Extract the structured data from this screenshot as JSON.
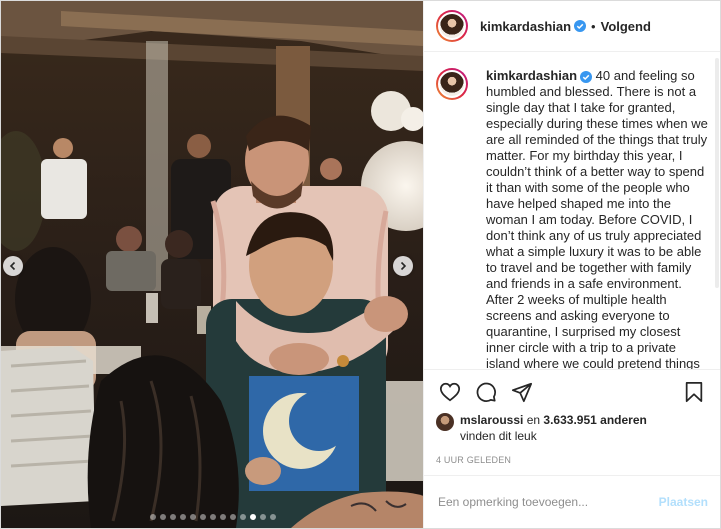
{
  "header": {
    "username": "kimkardashian",
    "separator": "•",
    "follow_label": "Volgend"
  },
  "caption": {
    "username": "kimkardashian",
    "text": "40 and feeling so humbled and blessed. There is not a single day that I take for granted, especially during these times when we are all reminded of the things that truly matter. For my birthday this year, I couldn’t think of a better way to spend it than with some of the people who have helped shaped me into the woman I am today. Before COVID, I don’t think any of us truly appreciated what a simple luxury it was to be able to travel and be together with family and friends in a safe environment. After 2 weeks of multiple health screens and asking everyone to quarantine, I surprised my closest inner circle with a trip to a private island where we could pretend things"
  },
  "likes": {
    "liker": "mslaroussi",
    "connector": "en",
    "count": "3.633.951",
    "others": "anderen",
    "line2": "vinden dit leuk"
  },
  "timestamp": "4 UUR GELEDEN",
  "comment_box": {
    "placeholder": "Een opmerking toevoegen...",
    "post_label": "Plaatsen"
  },
  "carousel": {
    "slide_count": 13,
    "active_index": 10
  },
  "colors": {
    "verified": "#3897f0",
    "post_button_disabled": "#b2dffc",
    "muted_text": "#8e8e8e",
    "border": "#dbdbdb"
  },
  "icons": [
    "chevron-left-icon",
    "chevron-right-icon",
    "verified-badge-icon",
    "heart-icon",
    "comment-icon",
    "share-icon",
    "bookmark-icon"
  ]
}
